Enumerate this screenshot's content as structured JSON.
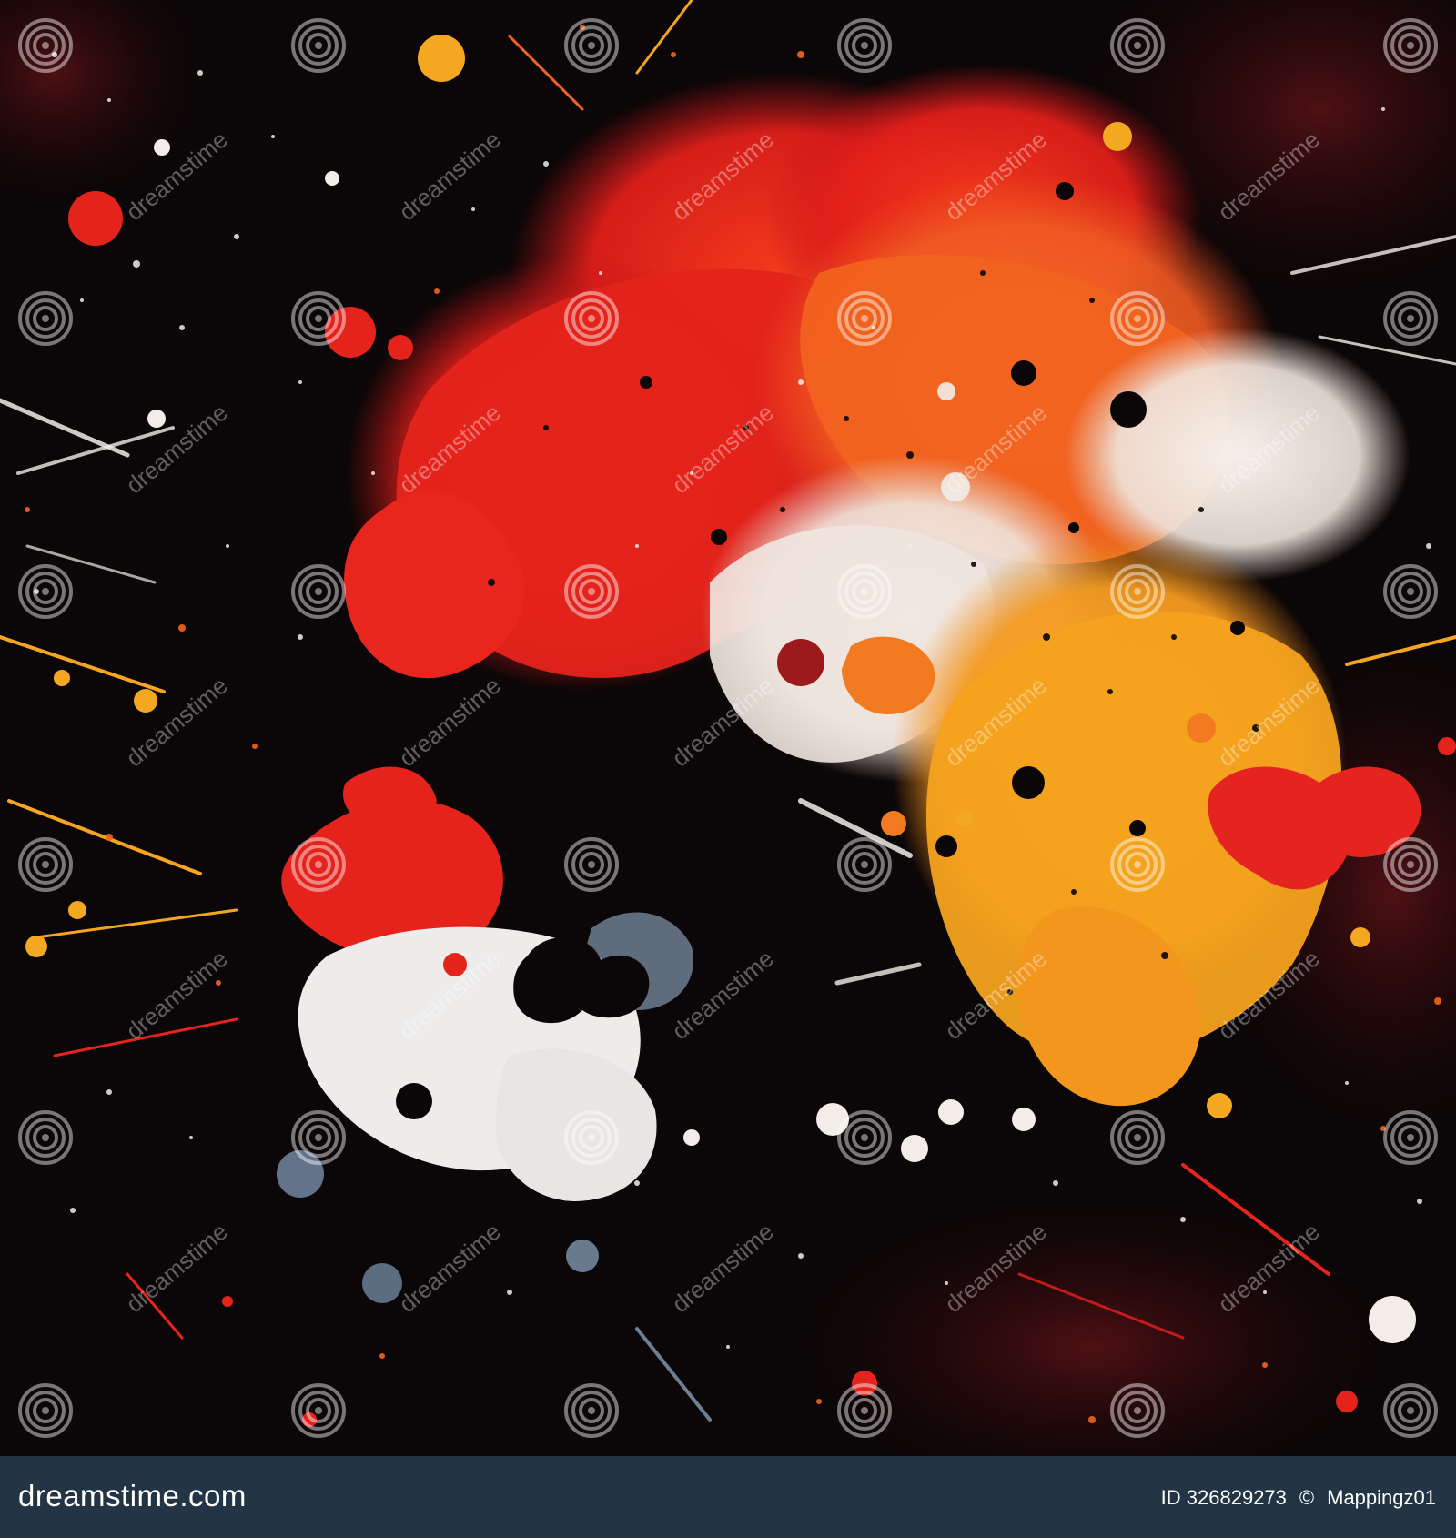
{
  "artwork": {
    "description_colors": {
      "background": "#0b0607",
      "red": "#e8231c",
      "orange": "#f2641f",
      "yellow": "#f5a51f",
      "white": "#f1ede6",
      "slate": "#6d7d8e"
    }
  },
  "watermark": {
    "text": "dreamstime",
    "icon": "spiral-icon"
  },
  "footer": {
    "logo_text": "dreamstime.com",
    "id_text": "ID 326829273",
    "author_text": "Mappingz01",
    "background_color": "#233544"
  }
}
